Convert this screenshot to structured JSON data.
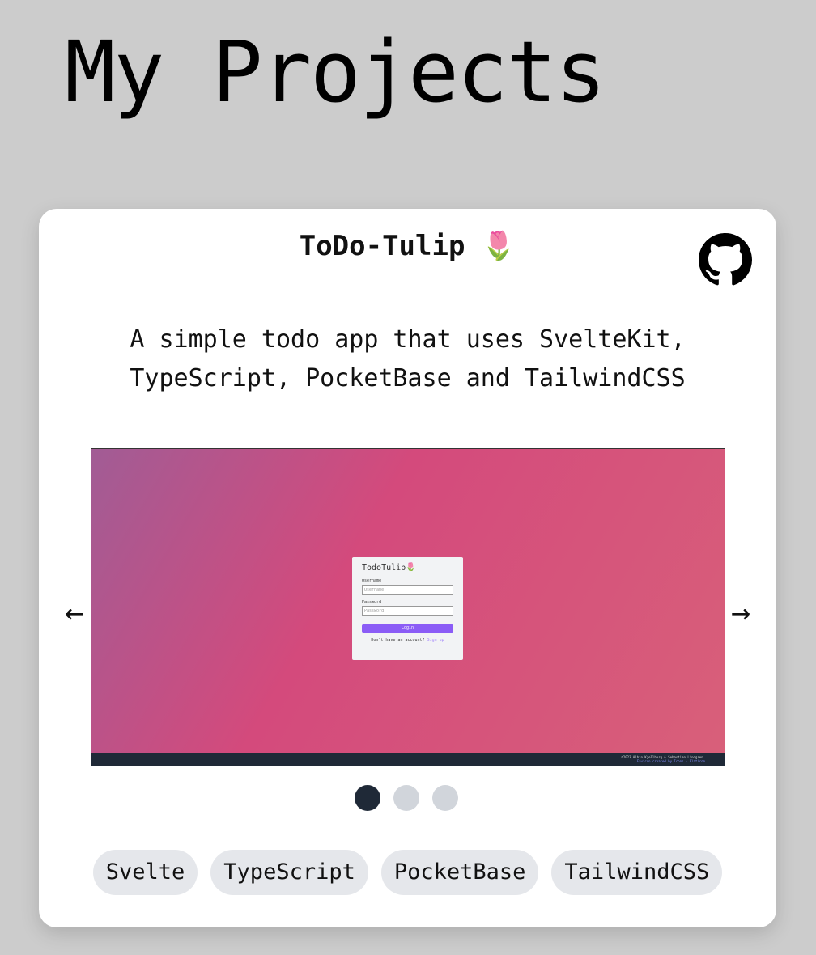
{
  "page": {
    "title": "My Projects"
  },
  "project": {
    "title": "ToDo-Tulip 🌷",
    "description": "A simple todo app that uses SvelteKit, TypeScript, PocketBase and TailwindCSS",
    "screenshot": {
      "app_title": "TodoTulip🌷",
      "username_label": "Username",
      "username_placeholder": "Username",
      "password_label": "Password",
      "password_placeholder": "Password",
      "login_button": "Login",
      "signup_prompt": "Don't have an account?",
      "signup_link": "Sign up",
      "footer_line1": "©2023 Albin Kjellberg & Sebastian Lindgren.",
      "footer_line2": "Favicon created by Icons - Flaticon"
    },
    "carousel": {
      "prev": "←",
      "next": "→",
      "current_slide": 1,
      "total_slides": 3
    },
    "tags": [
      "Svelte",
      "TypeScript",
      "PocketBase",
      "TailwindCSS"
    ]
  }
}
